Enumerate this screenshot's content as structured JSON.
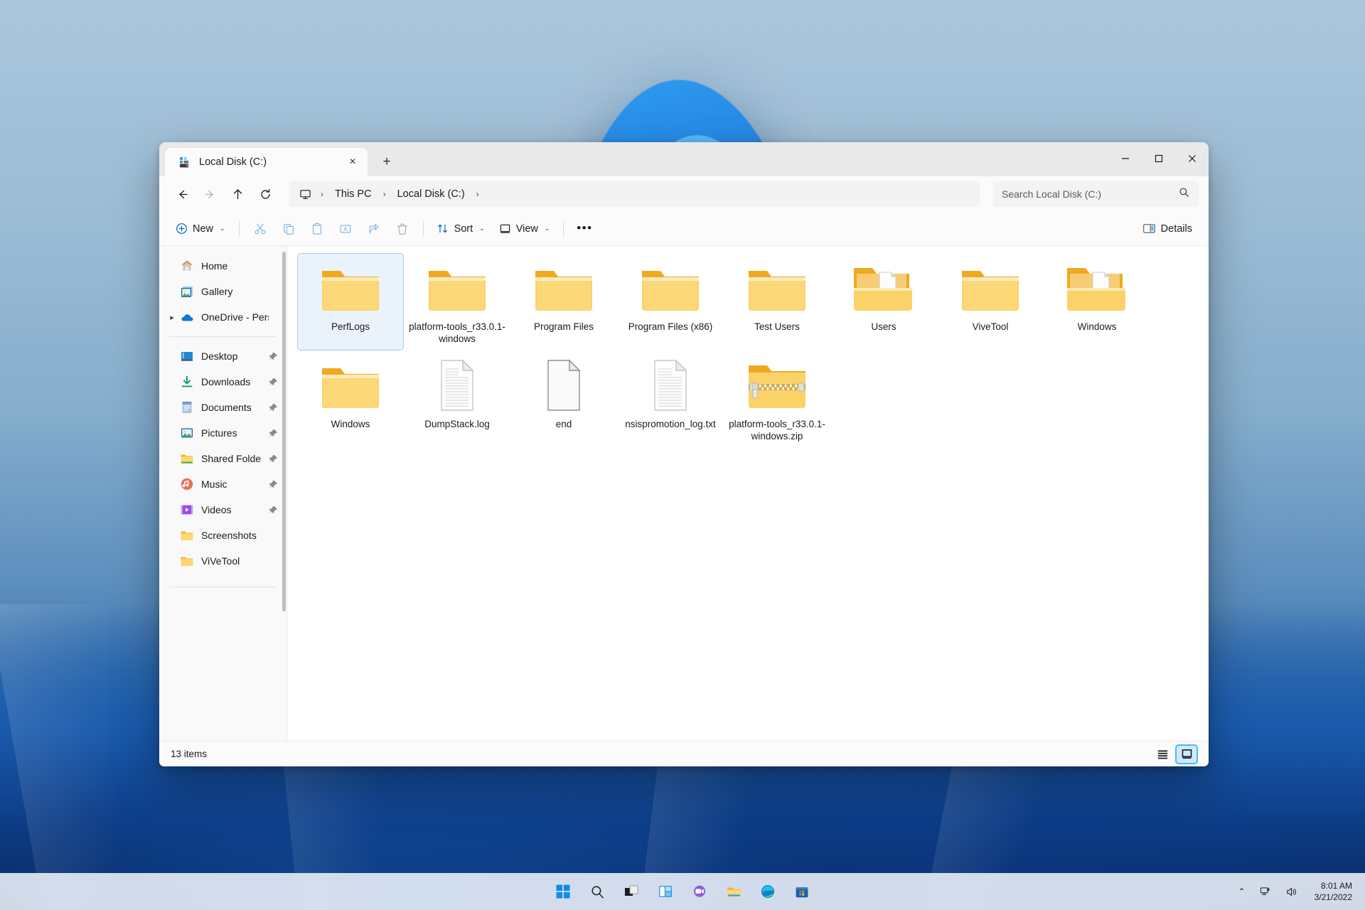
{
  "window": {
    "tab_title": "Local Disk (C:)",
    "tab_icon": "drive-icon",
    "new_tab_label": "+",
    "close_tab_label": "×",
    "minimize_label": "–",
    "maximize_label": "□",
    "close_label": "✕"
  },
  "nav": {
    "back": "back-arrow",
    "forward": "forward-arrow",
    "up": "up-arrow",
    "refresh": "refresh-icon",
    "breadcrumb": [
      "This PC",
      "Local Disk (C:)"
    ],
    "separator": "›",
    "trailing_separator": "›"
  },
  "search": {
    "placeholder": "Search Local Disk (C:)",
    "value": "",
    "icon": "search-icon"
  },
  "toolbar": {
    "new_label": "New",
    "sort_label": "Sort",
    "view_label": "View",
    "more_label": "•••",
    "details_label": "Details",
    "chevron": "⌄",
    "icons": [
      "cut-icon",
      "copy-icon",
      "paste-icon",
      "rename-icon",
      "share-icon",
      "delete-icon"
    ]
  },
  "sidebar": {
    "groups": [
      {
        "items": [
          {
            "label": "Home",
            "icon": "home-icon",
            "pinned": false,
            "expander": false
          },
          {
            "label": "Gallery",
            "icon": "gallery-icon",
            "pinned": false,
            "expander": false
          },
          {
            "label": "OneDrive - Pers",
            "icon": "onedrive-icon",
            "pinned": false,
            "expander": true
          }
        ]
      },
      {
        "items": [
          {
            "label": "Desktop",
            "icon": "desktop-icon",
            "pinned": true,
            "expander": false
          },
          {
            "label": "Downloads",
            "icon": "downloads-icon",
            "pinned": true,
            "expander": false
          },
          {
            "label": "Documents",
            "icon": "documents-icon",
            "pinned": true,
            "expander": false
          },
          {
            "label": "Pictures",
            "icon": "pictures-icon",
            "pinned": true,
            "expander": false
          },
          {
            "label": "Shared Folde",
            "icon": "folder-icon",
            "pinned": true,
            "expander": false
          },
          {
            "label": "Music",
            "icon": "music-icon",
            "pinned": true,
            "expander": false
          },
          {
            "label": "Videos",
            "icon": "videos-icon",
            "pinned": true,
            "expander": false
          },
          {
            "label": "Screenshots",
            "icon": "folder-icon",
            "pinned": false,
            "expander": false
          },
          {
            "label": "ViVeTool",
            "icon": "folder-icon",
            "pinned": false,
            "expander": false
          }
        ]
      }
    ],
    "pin_glyph": "📌"
  },
  "files": [
    {
      "name": "PerfLogs",
      "type": "folder",
      "selected": true
    },
    {
      "name": "platform-tools_r33.0.1-windows",
      "type": "folder",
      "selected": false
    },
    {
      "name": "Program Files",
      "type": "folder",
      "selected": false
    },
    {
      "name": "Program Files (x86)",
      "type": "folder",
      "selected": false
    },
    {
      "name": "Test Users",
      "type": "folder",
      "selected": false
    },
    {
      "name": "Users",
      "type": "folder-open-doc",
      "selected": false
    },
    {
      "name": "ViveTool",
      "type": "folder",
      "selected": false
    },
    {
      "name": "Windows",
      "type": "folder-open-doc",
      "selected": false
    },
    {
      "name": "Windows",
      "type": "folder",
      "selected": false
    },
    {
      "name": "DumpStack.log",
      "type": "file-text",
      "selected": false
    },
    {
      "name": "end",
      "type": "file-blank",
      "selected": false
    },
    {
      "name": "nsispromotion_log.txt",
      "type": "file-text",
      "selected": false
    },
    {
      "name": "platform-tools_r33.0.1-windows.zip",
      "type": "file-zip",
      "selected": false
    }
  ],
  "statusbar": {
    "item_count": "13 items",
    "list_view_label": "list-view",
    "icon_view_label": "icon-view",
    "active_view": "icon-view"
  },
  "taskbar": {
    "buttons": [
      {
        "name": "start-button",
        "icon": "windows-logo-icon"
      },
      {
        "name": "search-button",
        "icon": "search-icon"
      },
      {
        "name": "task-view-button",
        "icon": "task-view-icon"
      },
      {
        "name": "widgets-button",
        "icon": "widgets-icon"
      },
      {
        "name": "chat-button",
        "icon": "chat-icon"
      },
      {
        "name": "file-explorer-button",
        "icon": "folder-icon"
      },
      {
        "name": "edge-button",
        "icon": "edge-icon"
      },
      {
        "name": "store-button",
        "icon": "store-icon"
      }
    ],
    "tray": {
      "chevron": "⌃",
      "network_icon": "network-icon",
      "volume_icon": "volume-icon",
      "time": "8:01 AM",
      "date": "3/21/2022"
    }
  },
  "colors": {
    "accent": "#0067c0",
    "folder": "#ffca42",
    "selection": "#a8cdea"
  }
}
